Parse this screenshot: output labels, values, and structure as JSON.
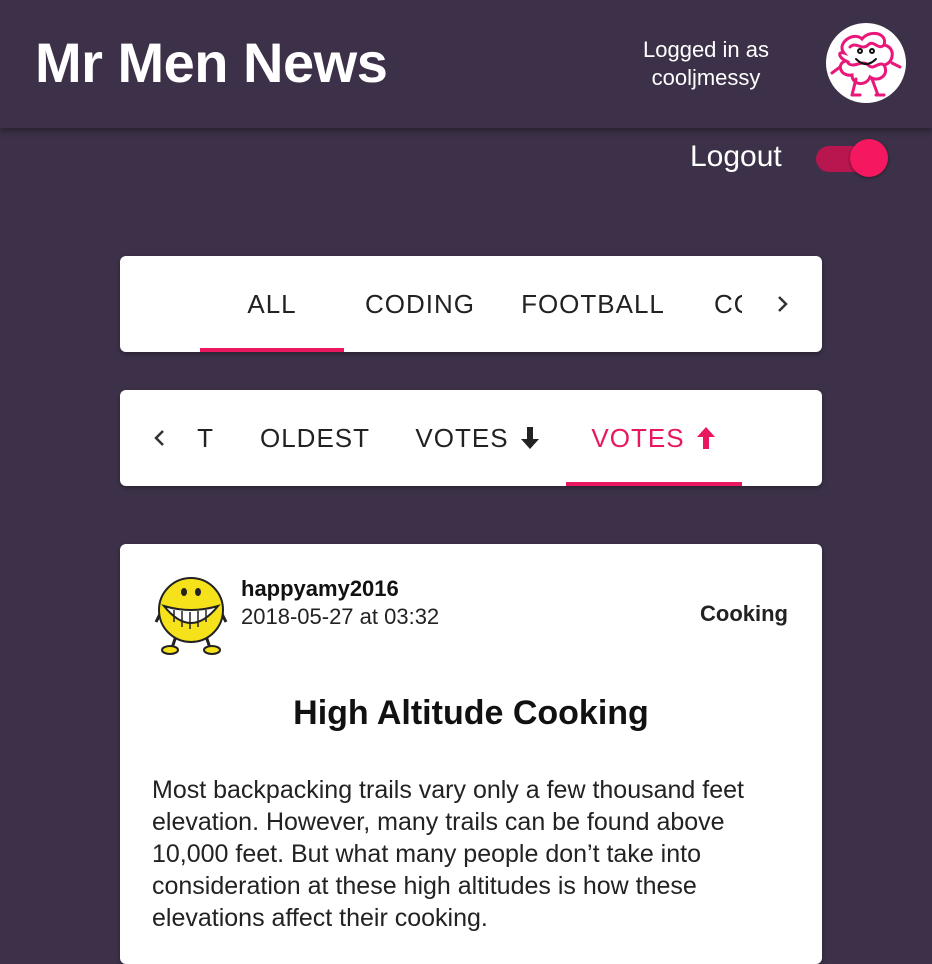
{
  "app": {
    "title": "Mr Men News",
    "logged_in_line1": "Logged in as",
    "username": "cooljmessy",
    "logout_label": "Logout",
    "logout_toggle_on": true,
    "accent_color": "#e9175d",
    "background_color": "#3c3148"
  },
  "topic_tabs": {
    "items": [
      {
        "label": "ALL",
        "active": true
      },
      {
        "label": "CODING",
        "active": false
      },
      {
        "label": "FOOTBALL",
        "active": false
      },
      {
        "label": "CO",
        "active": false
      }
    ],
    "next_icon": "chevron-right-icon"
  },
  "sort_tabs": {
    "prev_icon": "chevron-left-icon",
    "items": [
      {
        "label": "T",
        "active": false
      },
      {
        "label": "OLDEST",
        "active": false
      },
      {
        "label": "VOTES",
        "icon": "arrow-down-icon",
        "active": false
      },
      {
        "label": "VOTES",
        "icon": "arrow-up-icon",
        "active": true
      }
    ]
  },
  "article": {
    "author": "happyamy2016",
    "date": "2018-05-27 at 03:32",
    "topic": "Cooking",
    "title": "High Altitude Cooking",
    "body": "Most backpacking trails vary only a few thousand feet elevation. However, many trails can be found above 10,000 feet. But what many people don’t take into consideration at these high altitudes is how these elevations affect their cooking."
  }
}
